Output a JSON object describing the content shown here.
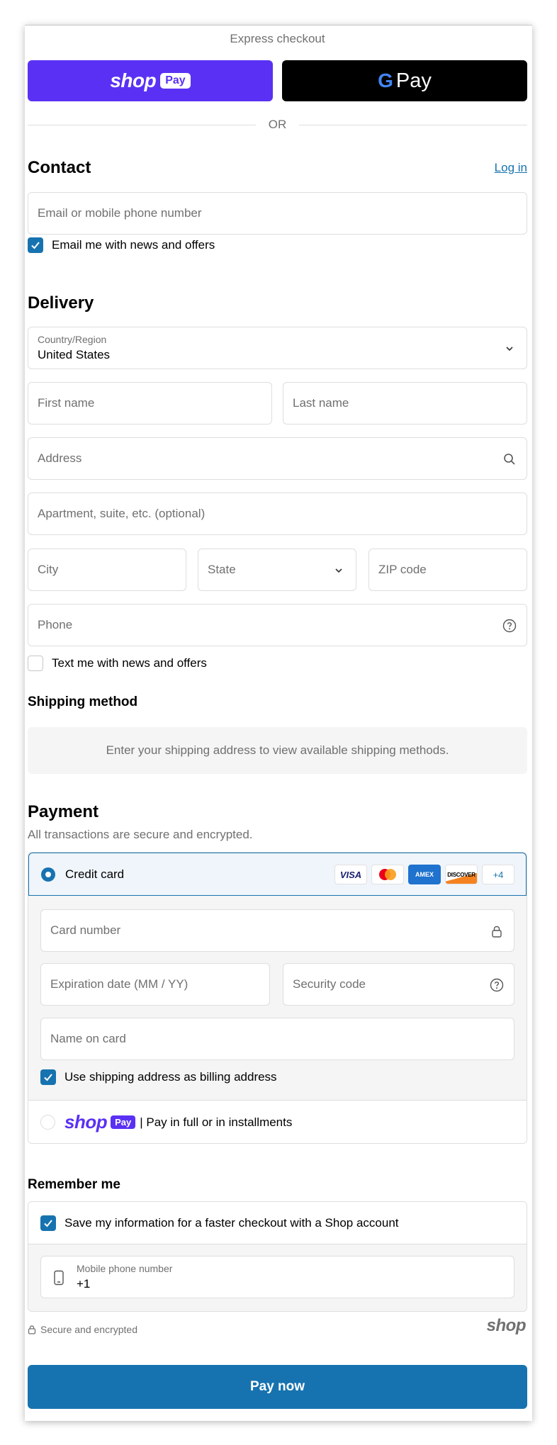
{
  "express": {
    "label": "Express checkout",
    "shop_pay": {
      "word": "shop",
      "pill": "Pay"
    },
    "google_pay": {
      "g": "G",
      "text": "Pay"
    },
    "divider": "OR"
  },
  "contact": {
    "title": "Contact",
    "login_link": "Log in",
    "email_placeholder": "Email or mobile phone number",
    "news_checkbox": {
      "label": "Email me with news and offers",
      "checked": true
    }
  },
  "delivery": {
    "title": "Delivery",
    "country": {
      "label": "Country/Region",
      "value": "United States"
    },
    "first_name_placeholder": "First name",
    "last_name_placeholder": "Last name",
    "address_placeholder": "Address",
    "apartment_placeholder": "Apartment, suite, etc. (optional)",
    "city_placeholder": "City",
    "state_placeholder": "State",
    "zip_placeholder": "ZIP code",
    "phone_placeholder": "Phone",
    "sms_checkbox": {
      "label": "Text me with news and offers",
      "checked": false
    }
  },
  "shipping": {
    "title": "Shipping method",
    "message": "Enter your shipping address to view available shipping methods."
  },
  "payment": {
    "title": "Payment",
    "subtitle": "All transactions are secure and encrypted.",
    "credit_card": {
      "label": "Credit card",
      "card_brands": [
        "VISA",
        "mastercard",
        "AMEX",
        "DISCOVER",
        "+4"
      ],
      "card_number_placeholder": "Card number",
      "expiration_placeholder": "Expiration date (MM / YY)",
      "security_code_placeholder": "Security code",
      "name_placeholder": "Name on card",
      "billing_checkbox": {
        "label": "Use shipping address as billing address",
        "checked": true
      }
    },
    "shop_pay_option": {
      "word": "shop",
      "pill": "Pay",
      "text": "| Pay in full or in installments"
    }
  },
  "remember": {
    "title": "Remember me",
    "save_checkbox": {
      "label": "Save my information for a faster checkout with a Shop account",
      "checked": true
    },
    "mobile": {
      "label": "Mobile phone number",
      "value": "+1"
    }
  },
  "footer": {
    "secure_text": "Secure and encrypted",
    "shop_mark": "shop",
    "pay_now": "Pay now"
  },
  "colors": {
    "accent": "#1773b0",
    "shop_purple": "#5a31f4",
    "muted_text": "#707070",
    "border": "#dedede",
    "panel_bg": "#f5f5f5"
  }
}
